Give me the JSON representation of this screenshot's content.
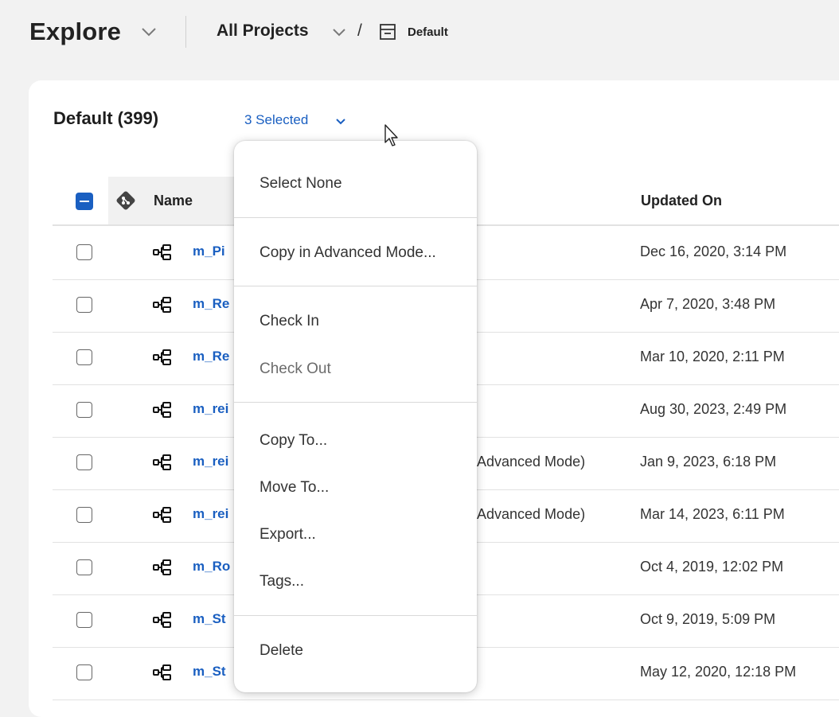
{
  "header": {
    "title": "Explore",
    "project": "All Projects",
    "separator": "/",
    "folder": "Default"
  },
  "panel": {
    "title": "Default (399)",
    "selection_label": "3 Selected"
  },
  "table": {
    "columns": {
      "name": "Name",
      "updated": "Updated On"
    },
    "rows": [
      {
        "name": "m_Pi",
        "desc": "",
        "updated": "Dec 16, 2020, 3:14 PM"
      },
      {
        "name": "m_Re",
        "desc": "",
        "updated": "Apr 7, 2020, 3:48 PM"
      },
      {
        "name": "m_Re",
        "desc": "",
        "updated": "Mar 10, 2020, 2:11 PM"
      },
      {
        "name": "m_rei",
        "desc": "",
        "updated": "Aug 30, 2023, 2:49 PM"
      },
      {
        "name": "m_rei",
        "desc": "Advanced Mode)",
        "updated": "Jan 9, 2023, 6:18 PM"
      },
      {
        "name": "m_rei",
        "desc": "Advanced Mode)",
        "updated": "Mar 14, 2023, 6:11 PM"
      },
      {
        "name": "m_Ro",
        "desc": "",
        "updated": "Oct 4, 2019, 12:02 PM"
      },
      {
        "name": "m_St",
        "desc": "",
        "updated": "Oct 9, 2019, 5:09 PM"
      },
      {
        "name": "m_St",
        "desc": "",
        "updated": "May 12, 2020, 12:18 PM"
      }
    ]
  },
  "menu": {
    "select_none": "Select None",
    "copy_advanced": "Copy in Advanced Mode...",
    "check_in": "Check In",
    "check_out": "Check Out",
    "copy_to": "Copy To...",
    "move_to": "Move To...",
    "export": "Export...",
    "tags": "Tags...",
    "delete": "Delete"
  },
  "colors": {
    "accent": "#1a5fc1",
    "background": "#f2f2f2",
    "panel": "#ffffff"
  },
  "icons": {
    "row_type": "mapping-icon",
    "source_control": "git-icon",
    "folder": "archive-box-icon"
  }
}
